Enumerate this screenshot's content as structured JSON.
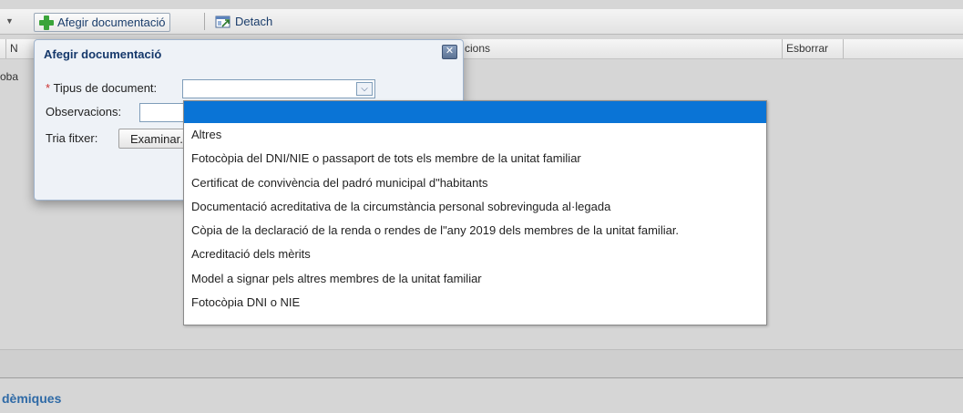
{
  "toolbar": {
    "add_label": "Afegir documentació",
    "detach_label": "Detach"
  },
  "grid": {
    "columns": [
      "N",
      "cions",
      "Esborrar"
    ],
    "row_text": "oba"
  },
  "dialog": {
    "title": "Afegir documentació",
    "type_label": "Tipus de document:",
    "required_mark": "*",
    "observations_label": "Observacions:",
    "file_label": "Tria fitxer:",
    "file_button": "Examinar..."
  },
  "dropdown": {
    "options": [
      "",
      "Altres",
      "Fotocòpia del DNI/NIE o passaport de tots els membre de la unitat familiar",
      "Certificat de convivència del padró municipal d\"habitants",
      "Documentació acreditativa de la circumstància personal sobrevinguda al·legada",
      "Còpia de la declaració de la renda o rendes de l\"any 2019 dels membres de la unitat familiar.",
      "Acreditació dels mèrits",
      "Model a signar pels altres membres de la unitat familiar",
      "Fotocòpia DNI o NIE"
    ]
  },
  "footer": {
    "section_title": "dèmiques"
  },
  "colors": {
    "selected_option": "#0a74d6",
    "link_blue": "#1a3d6b",
    "section_title": "#2f6aa6"
  }
}
